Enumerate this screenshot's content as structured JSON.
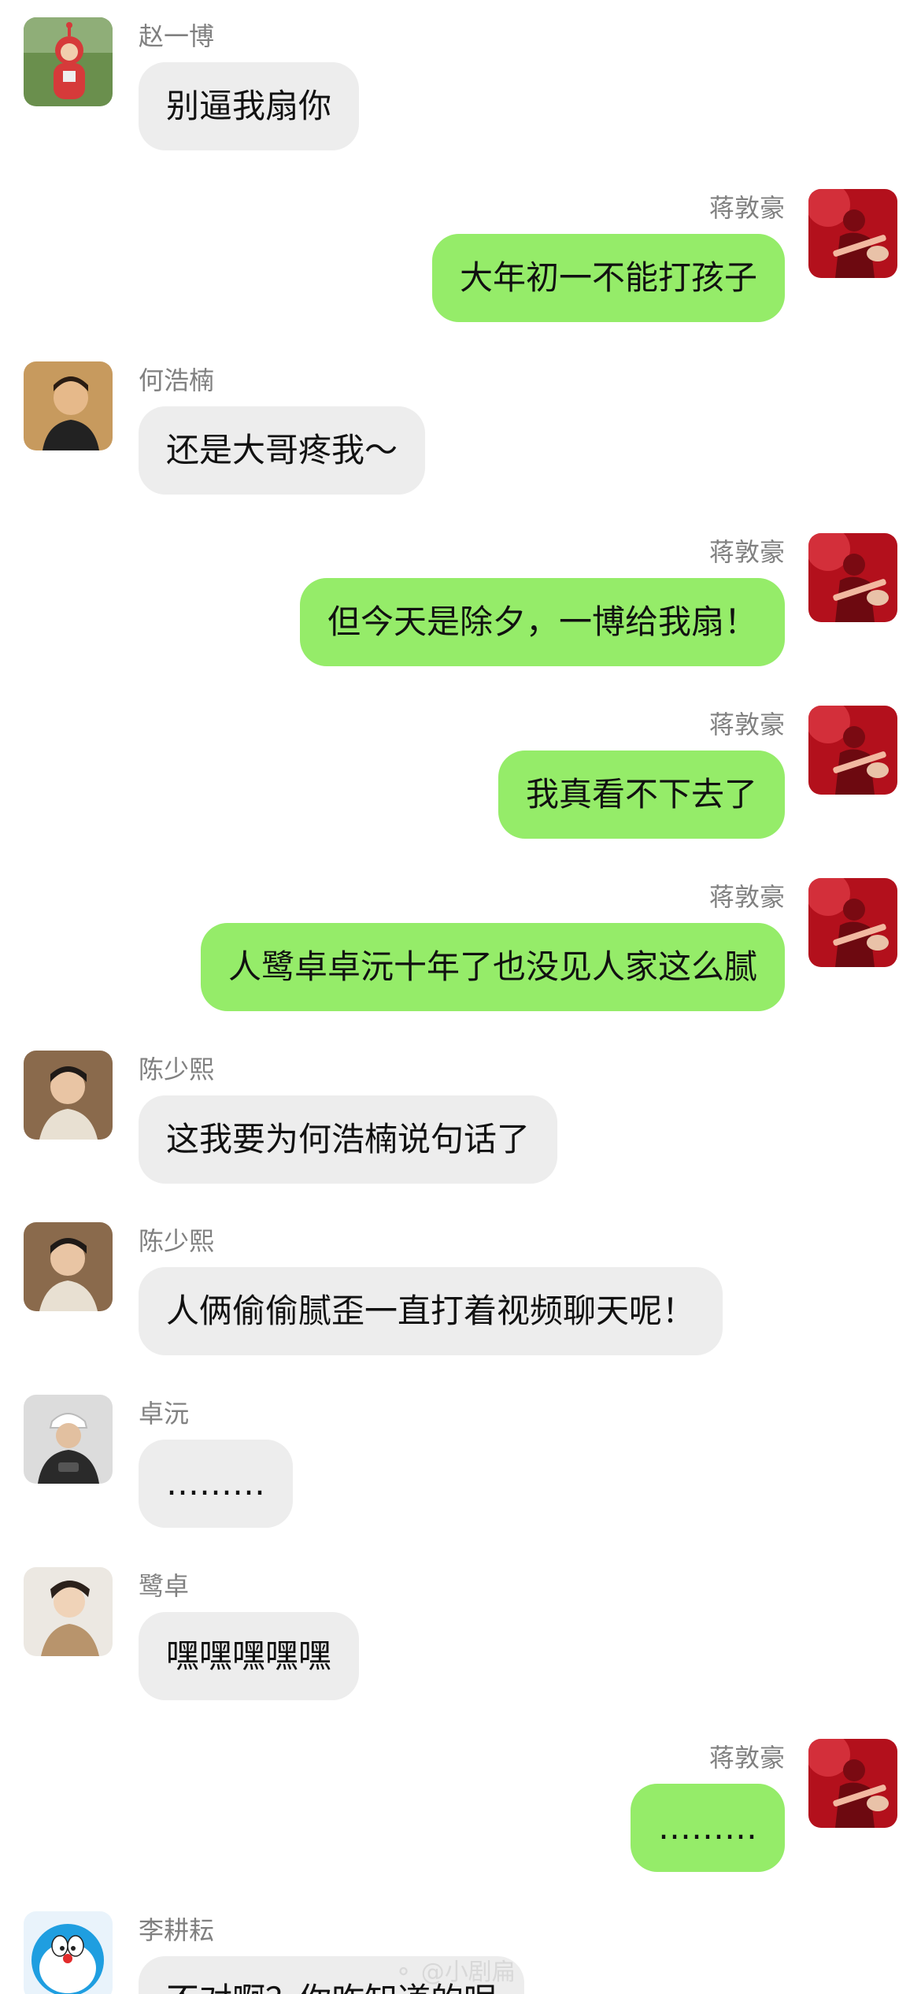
{
  "messages": [
    {
      "sender": "赵一博",
      "text": "别逼我扇你",
      "direction": "incoming",
      "avatar": "teletubby-avatar"
    },
    {
      "sender": "蒋敦豪",
      "text": "大年初一不能打孩子",
      "direction": "outgoing",
      "avatar": "guitar-stage-avatar"
    },
    {
      "sender": "何浩楠",
      "text": "还是大哥疼我～",
      "direction": "incoming",
      "avatar": "portrait-avatar"
    },
    {
      "sender": "蒋敦豪",
      "text": "但今天是除夕，一博给我扇！",
      "direction": "outgoing",
      "avatar": "guitar-stage-avatar"
    },
    {
      "sender": "蒋敦豪",
      "text": "我真看不下去了",
      "direction": "outgoing",
      "avatar": "guitar-stage-avatar"
    },
    {
      "sender": "蒋敦豪",
      "text": "人鹭卓卓沅十年了也没见人家这么腻",
      "direction": "outgoing",
      "avatar": "guitar-stage-avatar"
    },
    {
      "sender": "陈少熙",
      "text": "这我要为何浩楠说句话了",
      "direction": "incoming",
      "avatar": "portrait-avatar"
    },
    {
      "sender": "陈少熙",
      "text": "人俩偷偷腻歪一直打着视频聊天呢！",
      "direction": "incoming",
      "avatar": "portrait-avatar"
    },
    {
      "sender": "卓沅",
      "text": "………",
      "direction": "incoming",
      "avatar": "white-cap-avatar"
    },
    {
      "sender": "鹭卓",
      "text": "嘿嘿嘿嘿嘿",
      "direction": "incoming",
      "avatar": "portrait-avatar"
    },
    {
      "sender": "蒋敦豪",
      "text": "………",
      "direction": "outgoing",
      "avatar": "guitar-stage-avatar"
    },
    {
      "sender": "李耕耘",
      "text": "不对啊？你咋知道的呢",
      "direction": "incoming",
      "avatar": "doraemon-avatar"
    }
  ],
  "watermark": {
    "text": "@小剧扁"
  },
  "colors": {
    "incoming_bubble": "#ededed",
    "outgoing_bubble": "#95ec69",
    "sender_name": "#808080",
    "message_text": "#111111"
  }
}
